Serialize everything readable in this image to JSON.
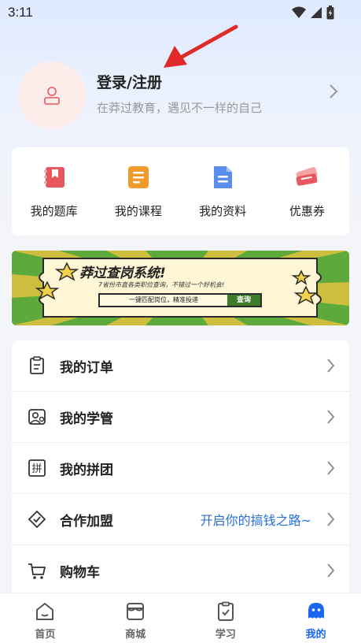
{
  "status_bar": {
    "time": "3:11"
  },
  "profile": {
    "title": "登录/注册",
    "subtitle": "在莽过教育，遇见不一样的自己"
  },
  "quick_links": [
    {
      "label": "我的题库",
      "icon": "question-bank-icon",
      "color": "#e8575d"
    },
    {
      "label": "我的课程",
      "icon": "course-icon",
      "color": "#f09a2a"
    },
    {
      "label": "我的资料",
      "icon": "document-icon",
      "color": "#5b8def"
    },
    {
      "label": "优惠券",
      "icon": "coupon-icon",
      "color": "#e8575d"
    }
  ],
  "banner": {
    "title": "莽过查岗系统!",
    "subtitle": "7省份市直各类职位查询，不错过一个好机会!",
    "search_text": "一键匹配岗位，精准投递",
    "search_button": "查询"
  },
  "menu": [
    {
      "label": "我的订单",
      "icon": "order-icon",
      "extra": ""
    },
    {
      "label": "我的学管",
      "icon": "tutor-icon",
      "extra": ""
    },
    {
      "label": "我的拼团",
      "icon": "group-buy-icon",
      "extra": ""
    },
    {
      "label": "合作加盟",
      "icon": "partnership-icon",
      "extra": "开启你的搞钱之路~"
    },
    {
      "label": "购物车",
      "icon": "cart-icon",
      "extra": ""
    }
  ],
  "bottom_nav": [
    {
      "label": "首页",
      "icon": "home-icon",
      "active": false
    },
    {
      "label": "商城",
      "icon": "store-icon",
      "active": false
    },
    {
      "label": "学习",
      "icon": "study-icon",
      "active": false
    },
    {
      "label": "我的",
      "icon": "profile-icon",
      "active": true
    }
  ],
  "colors": {
    "accent": "#1a66f0",
    "link": "#2a6fd6",
    "avatar_bg": "#fcecea",
    "banner_green": "#5ea93c"
  }
}
